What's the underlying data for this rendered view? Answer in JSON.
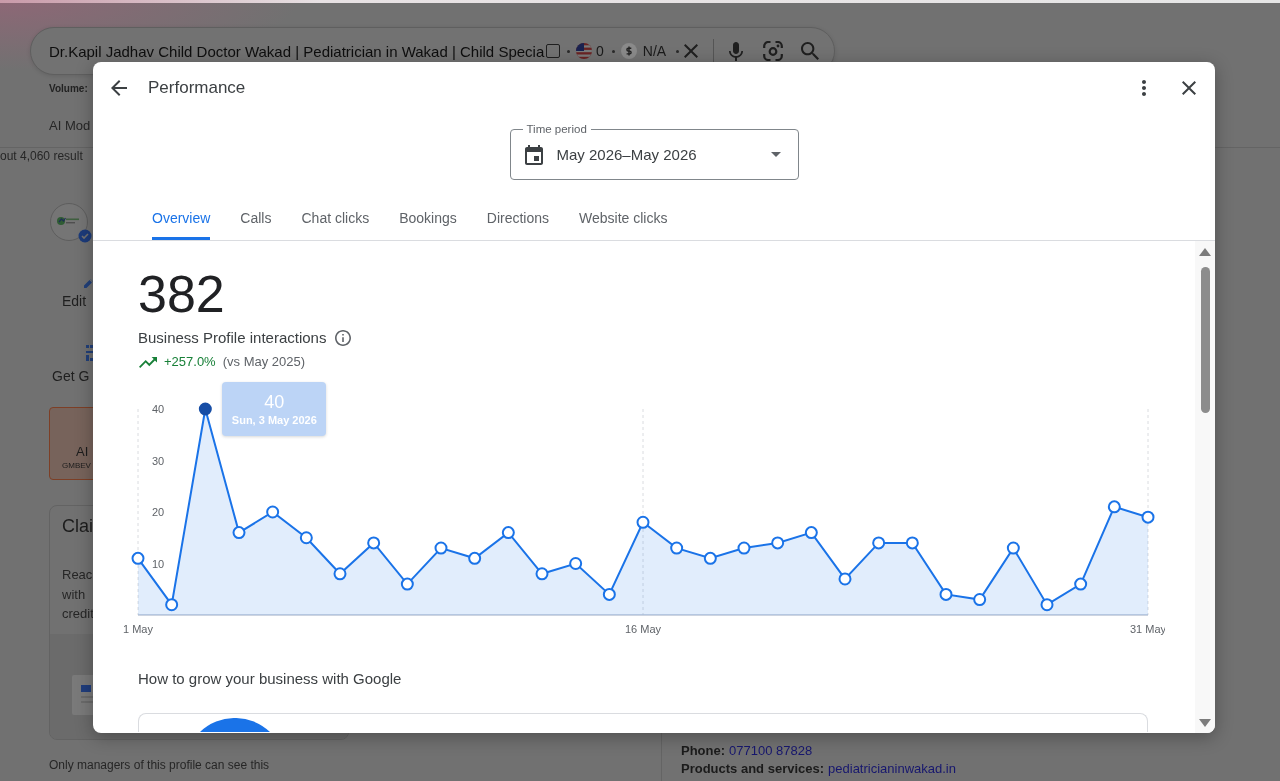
{
  "search_page": {
    "search_box": {
      "value": "Dr.Kapil Jadhav Child Doctor Wakad | Pediatrician in Wakad | Child Specia",
      "checkbox": {
        "checked": false
      },
      "flag_count": "0",
      "price": "N/A"
    },
    "volume_label": "Volume:",
    "nav_tab": "AI Mod",
    "result_count": "out 4,060 result",
    "profile_actions": [
      {
        "kind": "edit",
        "label": "Edit"
      },
      {
        "kind": "grid",
        "label": "Get G"
      }
    ],
    "ai_card": {
      "title": "AI",
      "code": "GMBEV"
    },
    "claim_card": {
      "title": "Clai",
      "lines": [
        "Reac",
        "with",
        "credit"
      ]
    },
    "managers_note": "Only managers of this profile can see this",
    "details": [
      {
        "label": "Phone:",
        "value": "077100 87828"
      },
      {
        "label": "Products and services:",
        "value": "pediatricianinwakad.in"
      }
    ]
  },
  "dialog": {
    "title": "Performance",
    "time_period": {
      "label": "Time period",
      "value": "May 2026–May 2026"
    },
    "tabs": [
      {
        "label": "Overview",
        "selected": true
      },
      {
        "label": "Calls",
        "selected": false
      },
      {
        "label": "Chat clicks",
        "selected": false
      },
      {
        "label": "Bookings",
        "selected": false
      },
      {
        "label": "Directions",
        "selected": false
      },
      {
        "label": "Website clicks",
        "selected": false
      }
    ],
    "overview": {
      "total": "382",
      "change": "+257.0%",
      "comparison": "(vs May 2025)",
      "chart_data": {
        "type": "area",
        "categories": [
          "1 May",
          null,
          null,
          null,
          null,
          null,
          null,
          null,
          null,
          null,
          null,
          null,
          null,
          null,
          null,
          "16 May",
          null,
          null,
          null,
          null,
          null,
          null,
          null,
          null,
          null,
          null,
          null,
          null,
          null,
          null,
          "31 May"
        ],
        "series": [
          {
            "name": "Business Profile interactions",
            "color": "#1a73e8",
            "values": [
              11,
              2,
              40,
              16,
              20,
              15,
              8,
              14,
              6,
              13,
              11,
              16,
              8,
              10,
              4,
              18,
              13,
              11,
              13,
              14,
              16,
              7,
              14,
              14,
              4,
              3,
              13,
              2,
              6,
              21,
              19
            ]
          }
        ],
        "ylim": [
          0,
          40
        ],
        "yticks": [
          10,
          20,
          30,
          40
        ],
        "annotations": [
          "40",
          "Sun, 3 May 2026"
        ]
      }
    },
    "section_title": "How to grow your business with Google"
  }
}
